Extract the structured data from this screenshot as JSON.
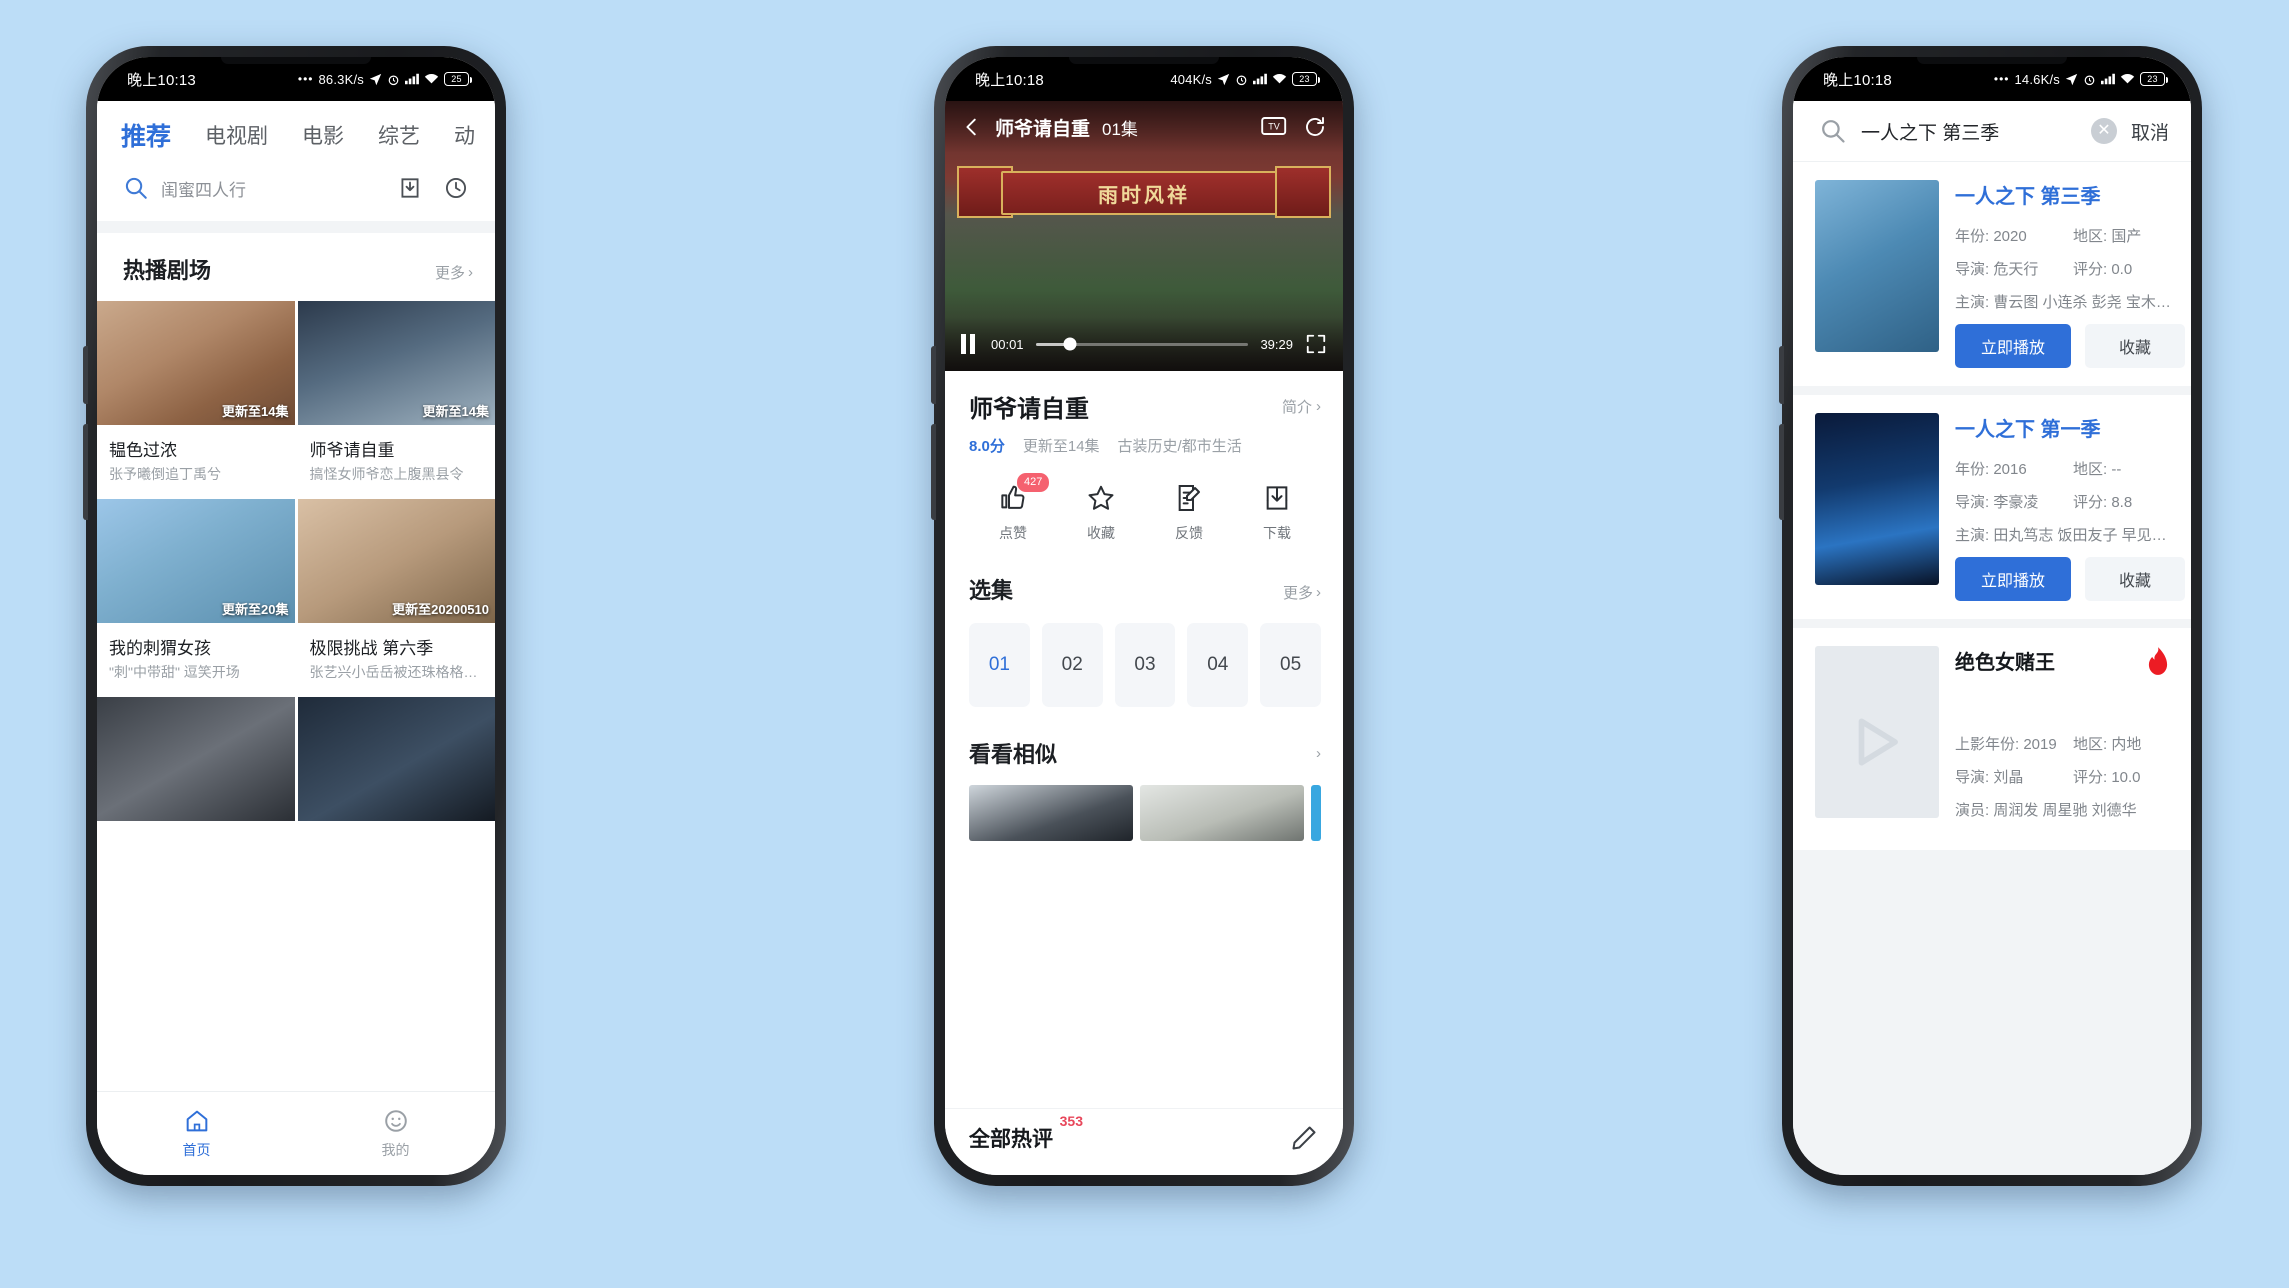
{
  "phone1": {
    "status": {
      "time": "晚上10:13",
      "dots": "•••",
      "speed": "86.3K/s",
      "battery": "25"
    },
    "tabs": [
      {
        "label": "推荐",
        "active": true
      },
      {
        "label": "电视剧",
        "active": false
      },
      {
        "label": "电影",
        "active": false
      },
      {
        "label": "综艺",
        "active": false
      },
      {
        "label": "动",
        "active": false
      }
    ],
    "menu_icon": "hamburger-icon",
    "search": {
      "placeholder": "闺蜜四人行",
      "icon": "search-icon"
    },
    "header_icons": [
      "download-icon",
      "history-icon"
    ],
    "section": {
      "title": "热播剧场",
      "more": "更多",
      "chevron": "›"
    },
    "cards": [
      {
        "title": "韫色过浓",
        "subtitle": "张予曦倒追丁禹兮",
        "badge": "更新至14集",
        "art": "a1"
      },
      {
        "title": "师爷请自重",
        "subtitle": "搞怪女师爷恋上腹黑县令",
        "badge": "更新至14集",
        "art": "a2"
      },
      {
        "title": "我的刺猬女孩",
        "subtitle": "\"刺\"中带甜\" 逗笑开场",
        "badge": "更新至20集",
        "art": "a3"
      },
      {
        "title": "极限挑战 第六季",
        "subtitle": "张艺兴小岳岳被还珠格格…",
        "badge": "更新至20200510",
        "art": "a4"
      },
      {
        "title": "",
        "subtitle": "",
        "badge": "",
        "art": "a5"
      },
      {
        "title": "",
        "subtitle": "",
        "badge": "",
        "art": "a6"
      }
    ],
    "nav": [
      {
        "label": "首页",
        "icon": "home-icon",
        "active": true
      },
      {
        "label": "我的",
        "icon": "smiley-icon",
        "active": false
      }
    ]
  },
  "phone2": {
    "status": {
      "time": "晚上10:18",
      "speed": "404K/s",
      "battery": "23"
    },
    "player": {
      "back_icon": "back-chevron-icon",
      "title": "师爷请自重",
      "episode": "01集",
      "tv_icon": "cast-tv-icon",
      "refresh_icon": "refresh-icon",
      "pause_icon": "pause-icon",
      "current_time": "00:01",
      "total_time": "39:29",
      "fullscreen_icon": "fullscreen-icon",
      "progress_percent": 1
    },
    "detail": {
      "title": "师爷请自重",
      "brief_label": "简介",
      "chevron": "›",
      "score": "8.0分",
      "update": "更新至14集",
      "genre": "古装历史/都市生活"
    },
    "actions": [
      {
        "label": "点赞",
        "icon": "thumbs-up-icon",
        "count": "427"
      },
      {
        "label": "收藏",
        "icon": "star-icon",
        "count": ""
      },
      {
        "label": "反馈",
        "icon": "feedback-icon",
        "count": ""
      },
      {
        "label": "下载",
        "icon": "download-icon",
        "count": ""
      }
    ],
    "episodes_section": {
      "title": "选集",
      "more": "更多",
      "chevron": "›"
    },
    "episodes": [
      {
        "num": "01",
        "active": true
      },
      {
        "num": "02",
        "active": false
      },
      {
        "num": "03",
        "active": false
      },
      {
        "num": "04",
        "active": false
      },
      {
        "num": "05",
        "active": false
      }
    ],
    "similar": {
      "title": "看看相似",
      "chevron": "›"
    },
    "comments": {
      "title": "全部热评",
      "count": "353",
      "edit_icon": "pencil-icon"
    }
  },
  "phone3": {
    "status": {
      "time": "晚上10:18",
      "speed": "14.6K/s",
      "battery": "23"
    },
    "search": {
      "icon": "search-icon",
      "value": "一人之下 第三季",
      "clear_icon": "clear-circle-icon",
      "cancel": "取消"
    },
    "results": [
      {
        "title": "一人之下 第三季",
        "title_style": "link",
        "art": "a7",
        "fields": [
          {
            "k": "年份: 2020",
            "v": "地区: 国产"
          },
          {
            "k": "导演: 危天行",
            "v": "评分: 0.0"
          }
        ],
        "cast": "主演: 曹云图 小连杀 彭尧 宝木…",
        "buttons": {
          "play": "立即播放",
          "fav": "收藏"
        },
        "hot": false
      },
      {
        "title": "一人之下 第一季",
        "title_style": "link",
        "art": "a8",
        "fields": [
          {
            "k": "年份: 2016",
            "v": "地区: --"
          },
          {
            "k": "导演: 李豪凌",
            "v": "评分: 8.8"
          }
        ],
        "cast": "主演: 田丸笃志 饭田友子 早见沙…",
        "buttons": {
          "play": "立即播放",
          "fav": "收藏"
        },
        "hot": false
      },
      {
        "title": "绝色女赌王",
        "title_style": "plain",
        "art": "placeholder",
        "fields": [
          {
            "k": "上影年份: 2019",
            "v": "地区: 内地"
          },
          {
            "k": "导演: 刘晶",
            "v": "评分: 10.0"
          }
        ],
        "cast": "演员: 周润发 周星驰 刘德华",
        "buttons": {
          "play": "",
          "fav": ""
        },
        "hot": true,
        "hot_icon": "flame-icon",
        "placeholder_icon": "play-placeholder-icon"
      }
    ]
  },
  "colors": {
    "accent_blue": "#2f6fd8",
    "page_bg": "#bcddf7",
    "badge_red": "#f5616f",
    "hot_red": "#ec1c24",
    "muted": "#9aa0a6"
  }
}
